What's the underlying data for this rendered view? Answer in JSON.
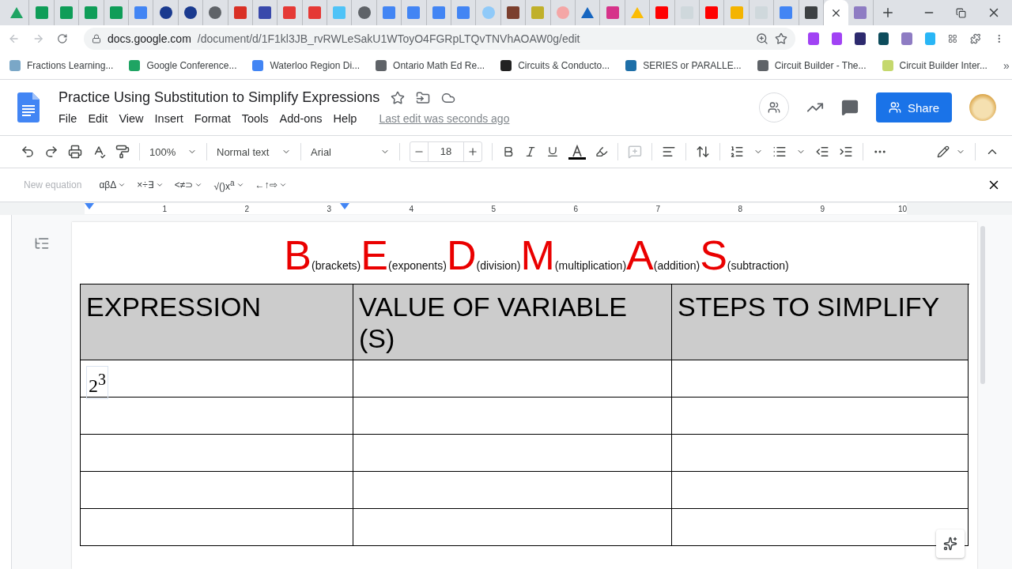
{
  "browser": {
    "tabs": [
      {
        "kind": "triangle",
        "color": "#1fa463",
        "selected": false
      },
      {
        "kind": "square",
        "color": "#0f9d58",
        "selected": false
      },
      {
        "kind": "square",
        "color": "#0f9d58",
        "selected": false
      },
      {
        "kind": "square",
        "color": "#0f9d58",
        "selected": false
      },
      {
        "kind": "square",
        "color": "#0f9d58",
        "selected": false
      },
      {
        "kind": "square",
        "color": "#4285f4",
        "selected": false
      },
      {
        "kind": "circle",
        "color": "#1a3a8f",
        "selected": false
      },
      {
        "kind": "circle",
        "color": "#1a3a8f",
        "selected": false
      },
      {
        "kind": "circle",
        "color": "#5f6368",
        "selected": false
      },
      {
        "kind": "square",
        "color": "#d93025",
        "selected": false
      },
      {
        "kind": "square",
        "color": "#3949ab",
        "selected": false
      },
      {
        "kind": "square",
        "color": "#e53935",
        "selected": false
      },
      {
        "kind": "square",
        "color": "#e53935",
        "selected": false
      },
      {
        "kind": "square",
        "color": "#4fc3f7",
        "selected": false
      },
      {
        "kind": "circle",
        "color": "#5f6368",
        "selected": false
      },
      {
        "kind": "square",
        "color": "#4285f4",
        "selected": false
      },
      {
        "kind": "square",
        "color": "#4285f4",
        "selected": false
      },
      {
        "kind": "square",
        "color": "#4285f4",
        "selected": false
      },
      {
        "kind": "square",
        "color": "#4285f4",
        "selected": false
      },
      {
        "kind": "circle",
        "color": "#90caf9",
        "selected": false
      },
      {
        "kind": "square",
        "color": "#7b3f2e",
        "selected": false
      },
      {
        "kind": "square",
        "color": "#c0b02a",
        "selected": false
      },
      {
        "kind": "circle",
        "color": "#f4a6a6",
        "selected": false
      },
      {
        "kind": "triangle",
        "color": "#1565c0",
        "selected": false
      },
      {
        "kind": "square",
        "color": "#d6338a",
        "selected": false
      },
      {
        "kind": "triangle",
        "color": "#fbbc04",
        "selected": false
      },
      {
        "kind": "square",
        "color": "#ff0000",
        "selected": false
      },
      {
        "kind": "square",
        "color": "#cfd8dc",
        "selected": false
      },
      {
        "kind": "square",
        "color": "#ff0000",
        "selected": false
      },
      {
        "kind": "square",
        "color": "#f4b400",
        "selected": false
      },
      {
        "kind": "square",
        "color": "#cfd8dc",
        "selected": false
      },
      {
        "kind": "square",
        "color": "#4285f4",
        "selected": false
      },
      {
        "kind": "square",
        "color": "#3c4043",
        "selected": false
      },
      {
        "selected": true
      },
      {
        "kind": "square",
        "color": "#8e7cc3",
        "selected": false
      }
    ],
    "url_host": "docs.google.com",
    "url_path": "/document/d/1F1kl3JB_rvRWLeSakU1WToyO4FGRpLTQvTNVhAOAW0g/edit",
    "bookmarks": [
      {
        "label": "Fractions Learning...",
        "color": "#7aa7c7"
      },
      {
        "label": "Google Conference...",
        "color": "#1fa463"
      },
      {
        "label": "Waterloo Region Di...",
        "color": "#4285f4"
      },
      {
        "label": "Ontario Math Ed Re...",
        "color": "#5f6368"
      },
      {
        "label": "Circuits & Conducto...",
        "color": "#222222"
      },
      {
        "label": "SERIES or PARALLE...",
        "color": "#1e6fa8"
      },
      {
        "label": "Circuit Builder - The...",
        "color": "#5f6368"
      },
      {
        "label": "Circuit Builder Inter...",
        "color": "#c5d86d"
      }
    ],
    "bookmarks_more": "»"
  },
  "document": {
    "title": "Practice Using Substitution to Simplify Expressions",
    "menu": [
      "File",
      "Edit",
      "View",
      "Insert",
      "Format",
      "Tools",
      "Add-ons",
      "Help"
    ],
    "last_edit": "Last edit was seconds ago",
    "share": "Share"
  },
  "toolbar": {
    "zoom": "100%",
    "style": "Normal text",
    "font": "Arial",
    "font_size": "18"
  },
  "equation_bar": {
    "new_equation": "New equation",
    "groups": [
      "αβΔ",
      "×÷∃",
      "<≠⊃",
      "√()x$^{a}$",
      "←↑⇨"
    ]
  },
  "ruler": [
    "1",
    "2",
    "3",
    "4",
    "5",
    "6",
    "7",
    "8",
    "9",
    "10"
  ],
  "heading": [
    {
      "letter": "B",
      "word": "(brackets)"
    },
    {
      "letter": "E",
      "word": "(exponents)"
    },
    {
      "letter": "D",
      "word": "(division)"
    },
    {
      "letter": "M",
      "word": "(multiplication)"
    },
    {
      "letter": "A",
      "word": "(addition)"
    },
    {
      "letter": "S",
      "word": "(subtraction)"
    }
  ],
  "table": {
    "columns": [
      "EXPRESSION",
      "VALUE OF VARIABLE (S)",
      "STEPS TO SIMPLIFY"
    ],
    "rows": [
      {
        "expression": "2$^{3}$"
      },
      {},
      {},
      {},
      {}
    ]
  }
}
